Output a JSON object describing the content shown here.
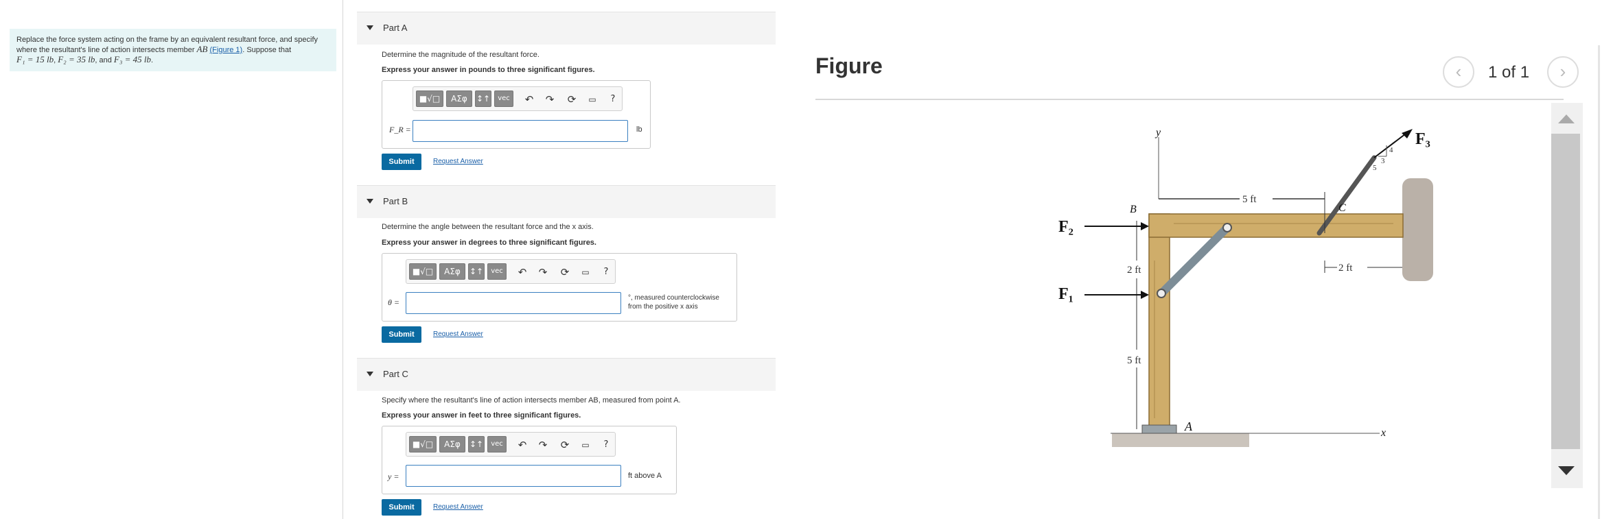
{
  "problem": {
    "text_1": "Replace the force system acting on the frame by an equivalent resultant force, and specify",
    "text_2a": "where the resultant's line of action intersects member ",
    "member": "AB",
    "figure_link": "(Figure 1)",
    "text_2b": ". Suppose that",
    "f1": "F₁ = 15 lb",
    "f2": "F₂ = 35 lb",
    "f3": "F₃ = 45 lb",
    "sep": ", ",
    "and": ", and "
  },
  "parts": [
    {
      "title": "Part A",
      "question": "Determine the magnitude of the resultant force.",
      "instruction": "Express your answer in pounds to three significant figures.",
      "var_label": "F_R =",
      "unit": "lb",
      "submit": "Submit",
      "request": "Request Answer"
    },
    {
      "title": "Part B",
      "question": "Determine the angle between the resultant force and the x axis.",
      "instruction": "Express your answer in degrees to three significant figures.",
      "var_label": "θ =",
      "unit_1": "°, measured counterclockwise",
      "unit_2": "from the positive x axis",
      "submit": "Submit",
      "request": "Request Answer"
    },
    {
      "title": "Part C",
      "question": "Specify where the resultant's line of action intersects member AB, measured from point A.",
      "instruction": "Express your answer in feet to three significant figures.",
      "var_label": "y =",
      "unit": "ft above A",
      "submit": "Submit",
      "request": "Request Answer"
    }
  ],
  "toolbar": {
    "templates": "■√□",
    "greek": "AΣφ",
    "arrows": "↕↑",
    "vec": "vec",
    "help": "?",
    "icons": [
      "undo-icon",
      "redo-icon",
      "reset-icon",
      "keyboard-icon",
      "help-icon"
    ]
  },
  "figure": {
    "title": "Figure",
    "pager": "1 of 1",
    "labels": {
      "f1": "F₁",
      "f2": "F₂",
      "f3": "F₃",
      "b": "B",
      "c": "C",
      "a": "A",
      "x": "x",
      "y": "y",
      "d5ft_top": "5 ft",
      "d2ft_left": "2 ft",
      "d2ft_right": "2 ft",
      "d5ft_left": "5 ft",
      "slope_5": "5",
      "slope_3": "3",
      "slope_4": "4"
    }
  }
}
